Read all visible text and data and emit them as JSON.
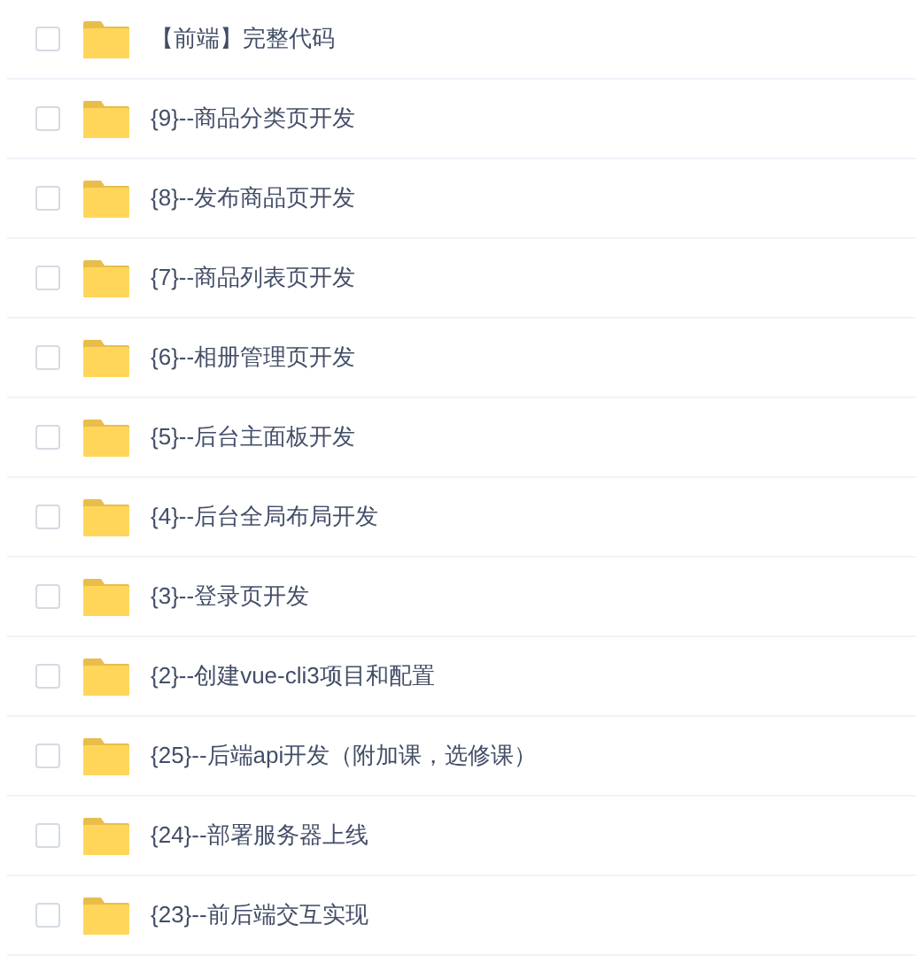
{
  "files": [
    {
      "name": "【前端】完整代码",
      "checked": false
    },
    {
      "name": "{9}--商品分类页开发",
      "checked": false
    },
    {
      "name": "{8}--发布商品页开发",
      "checked": false
    },
    {
      "name": "{7}--商品列表页开发",
      "checked": false
    },
    {
      "name": "{6}--相册管理页开发",
      "checked": false
    },
    {
      "name": "{5}--后台主面板开发",
      "checked": false
    },
    {
      "name": "{4}--后台全局布局开发",
      "checked": false
    },
    {
      "name": "{3}--登录页开发",
      "checked": false
    },
    {
      "name": "{2}--创建vue-cli3项目和配置",
      "checked": false
    },
    {
      "name": "{25}--后端api开发（附加课，选修课）",
      "checked": false
    },
    {
      "name": "{24}--部署服务器上线",
      "checked": false
    },
    {
      "name": "{23}--前后端交互实现",
      "checked": false
    }
  ]
}
